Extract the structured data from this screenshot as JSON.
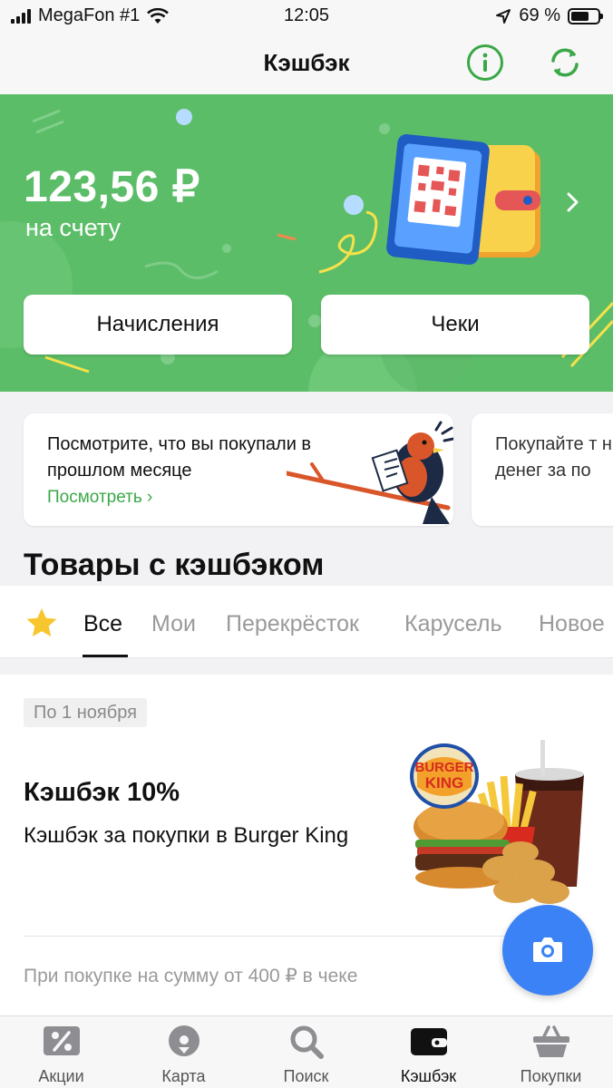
{
  "status_bar": {
    "carrier": "MegaFon #1",
    "time": "12:05",
    "battery": "69 %",
    "battery_level": 0.69
  },
  "nav": {
    "title": "Кэшбэк",
    "info_icon": "info-icon",
    "refresh_icon": "refresh-icon"
  },
  "hero": {
    "balance": "123,56 ₽",
    "balance_caption": "на счету",
    "accruals_button": "Начисления",
    "receipts_button": "Чеки",
    "background_color": "#5cbd68"
  },
  "promos": [
    {
      "text": "Посмотрите, что вы покупали в прошлом месяце",
      "link": "Посмотреть ›"
    },
    {
      "text": "Покупайте т ниже и возв денег за по"
    }
  ],
  "section_title": "Товары с кэшбэком",
  "tabs": {
    "favorites_icon": "star-icon",
    "items": [
      "Все",
      "Мои",
      "Перекрёсток",
      "Карусель",
      "Новое"
    ],
    "active_index": 0
  },
  "offer": {
    "date_badge": "По 1 ноября",
    "title": "Кэшбэк 10%",
    "description": "Кэшбэк за покупки в Burger King",
    "logo_line1": "BURGER",
    "logo_line2": "KING",
    "condition": "При покупке на сумму от 400 ₽ в чеке"
  },
  "fab": {
    "icon": "camera-icon"
  },
  "tabbar": {
    "items": [
      {
        "label": "Акции",
        "icon": "discount-icon"
      },
      {
        "label": "Карта",
        "icon": "map-pin-icon"
      },
      {
        "label": "Поиск",
        "icon": "search-icon"
      },
      {
        "label": "Кэшбэк",
        "icon": "wallet-icon"
      },
      {
        "label": "Покупки",
        "icon": "basket-icon"
      }
    ],
    "active_index": 3
  },
  "colors": {
    "accent_green": "#3aa847",
    "fab_blue": "#3b82f6"
  }
}
